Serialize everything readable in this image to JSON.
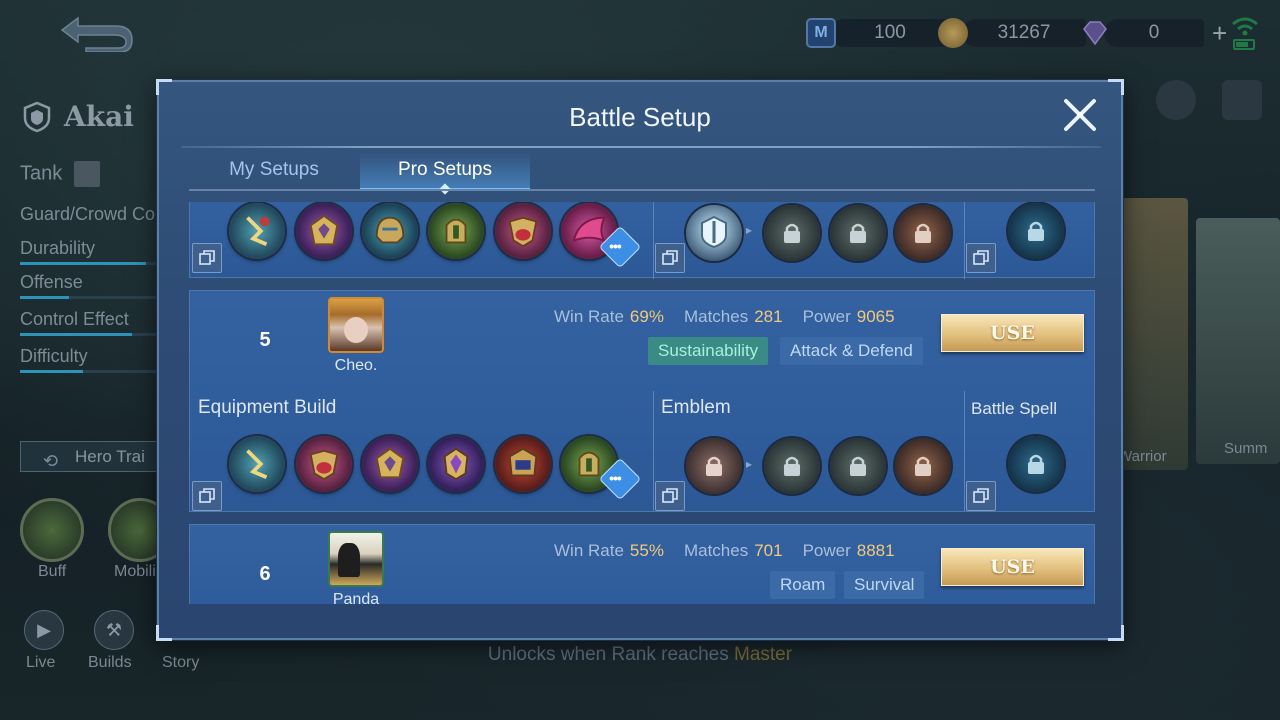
{
  "currency": {
    "tickets": "100",
    "gold": "31267",
    "diamonds": "0"
  },
  "hero": {
    "name": "Akai",
    "role": "Tank",
    "specialty": "Guard/Crowd Co",
    "stats": [
      "Durability",
      "Offense",
      "Control Effect",
      "Difficulty"
    ],
    "stat_levels": [
      0.9,
      0.35,
      0.8,
      0.45
    ],
    "training_button": "Hero Trai",
    "quick_actions": [
      "Buff",
      "Mobili"
    ],
    "bottom_nav": [
      "Live",
      "Builds",
      "Story"
    ]
  },
  "background_labels": {
    "warrior": "Warrior",
    "summon": "Summ",
    "unlock_note_prefix": "Unlocks when Rank reaches",
    "unlock_note_rank": "Master"
  },
  "modal": {
    "title": "Battle Setup",
    "tabs": [
      {
        "label": "My Setups",
        "active": false
      },
      {
        "label": "Pro Setups",
        "active": true
      }
    ],
    "labels": {
      "equipment": "Equipment Build",
      "emblem": "Emblem",
      "spell": "Battle Spell",
      "win_rate": "Win Rate",
      "matches": "Matches",
      "power": "Power",
      "use": "USE",
      "more": "•••"
    },
    "setups": [
      {
        "rank": "5",
        "player": "Cheo.",
        "win_rate": "69%",
        "matches": "281",
        "power": "9065",
        "tags": [
          "Sustainability",
          "Attack & Defend"
        ]
      },
      {
        "rank": "6",
        "player": "Panda",
        "win_rate": "55%",
        "matches": "701",
        "power": "8881",
        "tags": [
          "Roam",
          "Survival"
        ]
      }
    ]
  },
  "colors": {
    "accent_gold": "#f0c97d",
    "tag_green": "#3a8a86",
    "tag_blue": "#3b6aa6",
    "modal_bg": "#2f4f79"
  }
}
